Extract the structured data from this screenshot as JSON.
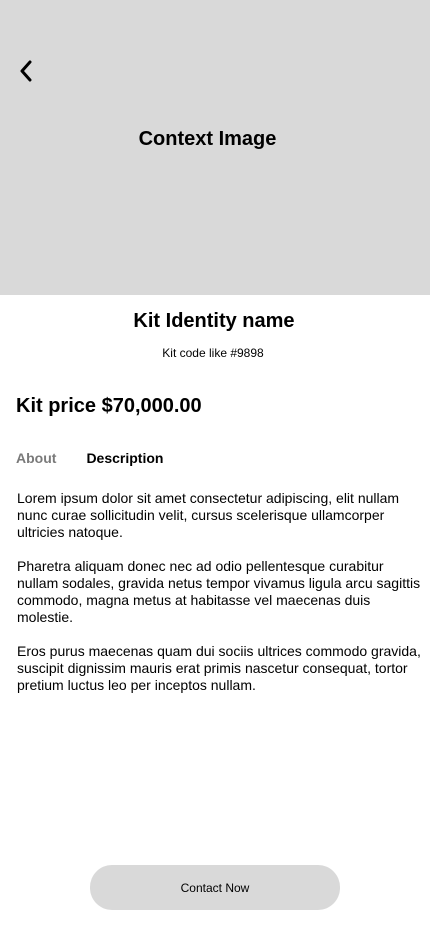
{
  "hero": {
    "label": "Context Image",
    "back_icon": "chevron-left-icon",
    "background_color": "#d9d9d9"
  },
  "kit": {
    "name": "Kit Identity name",
    "code": "Kit code like #9898",
    "price": "Kit price $70,000.00"
  },
  "tabs": [
    {
      "label": "About",
      "active": false
    },
    {
      "label": "Description",
      "active": true
    }
  ],
  "description": {
    "paragraphs": [
      "Lorem ipsum dolor sit amet consectetur adipiscing, elit nullam nunc curae sollicitudin velit, cursus scelerisque ullamcorper ultricies natoque.",
      "Pharetra aliquam donec nec ad odio pellentesque curabitur nullam sodales, gravida netus tempor vivamus ligula arcu sagittis commodo, magna metus at habitasse vel maecenas duis molestie.",
      "Eros purus maecenas quam dui sociis ultrices commodo gravida, suscipit dignissim mauris erat primis nascetur consequat, tortor pretium luctus leo per inceptos nullam."
    ]
  },
  "footer": {
    "contact_label": "Contact Now"
  },
  "colors": {
    "placeholder_gray": "#d9d9d9",
    "inactive_tab": "#7a7a7a",
    "text": "#000000"
  }
}
